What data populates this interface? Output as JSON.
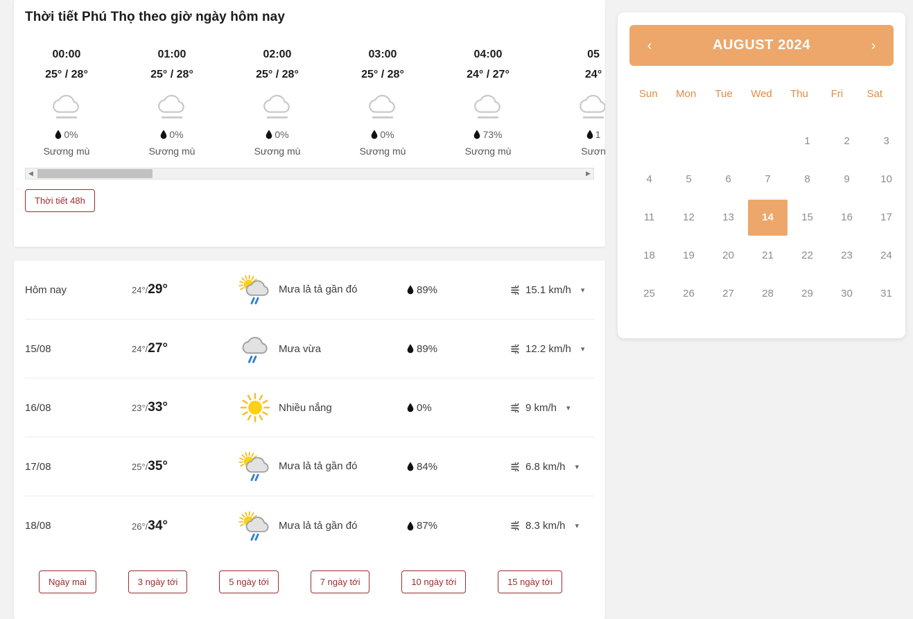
{
  "hourly": {
    "title": "Thời tiết Phú Thọ theo giờ ngày hôm nay",
    "columns": [
      {
        "time": "00:00",
        "temp": "25° / 28°",
        "pop": "0%",
        "desc": "Sương mù",
        "icon": "fog-icon"
      },
      {
        "time": "01:00",
        "temp": "25° / 28°",
        "pop": "0%",
        "desc": "Sương mù",
        "icon": "fog-icon"
      },
      {
        "time": "02:00",
        "temp": "25° / 28°",
        "pop": "0%",
        "desc": "Sương mù",
        "icon": "fog-icon"
      },
      {
        "time": "03:00",
        "temp": "25° / 28°",
        "pop": "0%",
        "desc": "Sương mù",
        "icon": "fog-icon"
      },
      {
        "time": "04:00",
        "temp": "24° / 27°",
        "pop": "73%",
        "desc": "Sương mù",
        "icon": "fog-icon"
      },
      {
        "time": "05",
        "temp": "24°",
        "pop": "1",
        "desc": "Sươn",
        "icon": "fog-icon"
      }
    ],
    "scroll_left_arrow": "◀",
    "scroll_right_arrow": "▶",
    "btn_48h": "Thời tiết 48h"
  },
  "daily": {
    "rows": [
      {
        "date": "Hôm nay",
        "low": "24°/",
        "high": "29°",
        "cond": "Mưa lả tả gần đó",
        "icon": "sun-cloud-rain-icon",
        "humidity": "89%",
        "wind": "15.1 km/h"
      },
      {
        "date": "15/08",
        "low": "24°/",
        "high": "27°",
        "cond": "Mưa vừa",
        "icon": "cloud-rain-icon",
        "humidity": "89%",
        "wind": "12.2 km/h"
      },
      {
        "date": "16/08",
        "low": "23°/",
        "high": "33°",
        "cond": "Nhiều nắng",
        "icon": "sun-icon",
        "humidity": "0%",
        "wind": "9 km/h"
      },
      {
        "date": "17/08",
        "low": "25°/",
        "high": "35°",
        "cond": "Mưa lả tả gần đó",
        "icon": "sun-cloud-rain-icon",
        "humidity": "84%",
        "wind": "6.8 km/h"
      },
      {
        "date": "18/08",
        "low": "26°/",
        "high": "34°",
        "cond": "Mưa lả tả gần đó",
        "icon": "sun-cloud-rain-icon",
        "humidity": "87%",
        "wind": "8.3 km/h"
      }
    ],
    "buttons": [
      "Ngày mai",
      "3 ngày tới",
      "5 ngày tới",
      "7 ngày tới",
      "10 ngày tới",
      "15 ngày tới"
    ]
  },
  "calendar": {
    "title": "AUGUST 2024",
    "prev": "‹",
    "next": "›",
    "dow": [
      "Sun",
      "Mon",
      "Tue",
      "Wed",
      "Thu",
      "Fri",
      "Sat"
    ],
    "leading_blanks": 4,
    "days": [
      1,
      2,
      3,
      4,
      5,
      6,
      7,
      8,
      9,
      10,
      11,
      12,
      13,
      14,
      15,
      16,
      17,
      18,
      19,
      20,
      21,
      22,
      23,
      24,
      25,
      26,
      27,
      28,
      29,
      30,
      31
    ],
    "today": 14,
    "accent_color": "#eda76a"
  }
}
